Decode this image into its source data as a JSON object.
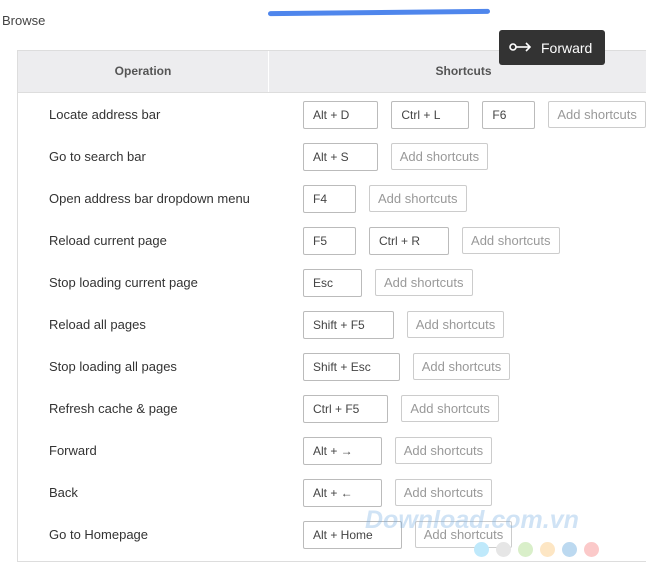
{
  "section_title": "Browse",
  "tooltip": {
    "icon": "forward-key-icon",
    "label": "Forward"
  },
  "table": {
    "headers": [
      "Operation",
      "Shortcuts"
    ],
    "add_label": "Add shortcuts",
    "rows": [
      {
        "operation": "Locate address bar",
        "keys": [
          "Alt + D",
          "Ctrl + L",
          "F6"
        ]
      },
      {
        "operation": "Go to search bar",
        "keys": [
          "Alt + S"
        ]
      },
      {
        "operation": "Open address bar dropdown menu",
        "keys": [
          "F4"
        ]
      },
      {
        "operation": "Reload current page",
        "keys": [
          "F5",
          "Ctrl + R"
        ]
      },
      {
        "operation": "Stop loading current page",
        "keys": [
          "Esc"
        ]
      },
      {
        "operation": "Reload all pages",
        "keys": [
          "Shift + F5"
        ]
      },
      {
        "operation": "Stop loading all pages",
        "keys": [
          "Shift + Esc"
        ]
      },
      {
        "operation": "Refresh cache & page",
        "keys": [
          "Ctrl + F5"
        ]
      },
      {
        "operation": "Forward",
        "keys": [
          "Alt + →"
        ]
      },
      {
        "operation": "Back",
        "keys": [
          "Alt + ←"
        ]
      },
      {
        "operation": "Go to Homepage",
        "keys": [
          "Alt + Home"
        ]
      }
    ]
  },
  "watermark": "Download.com.vn",
  "colors": {
    "accent_stroke": "#4f86ec",
    "tooltip_bg": "#333333",
    "dots": [
      "#bfe9fb",
      "#e6e6e6",
      "#d9efc9",
      "#fde6c4",
      "#bcd9f0",
      "#fbc9c9"
    ]
  }
}
